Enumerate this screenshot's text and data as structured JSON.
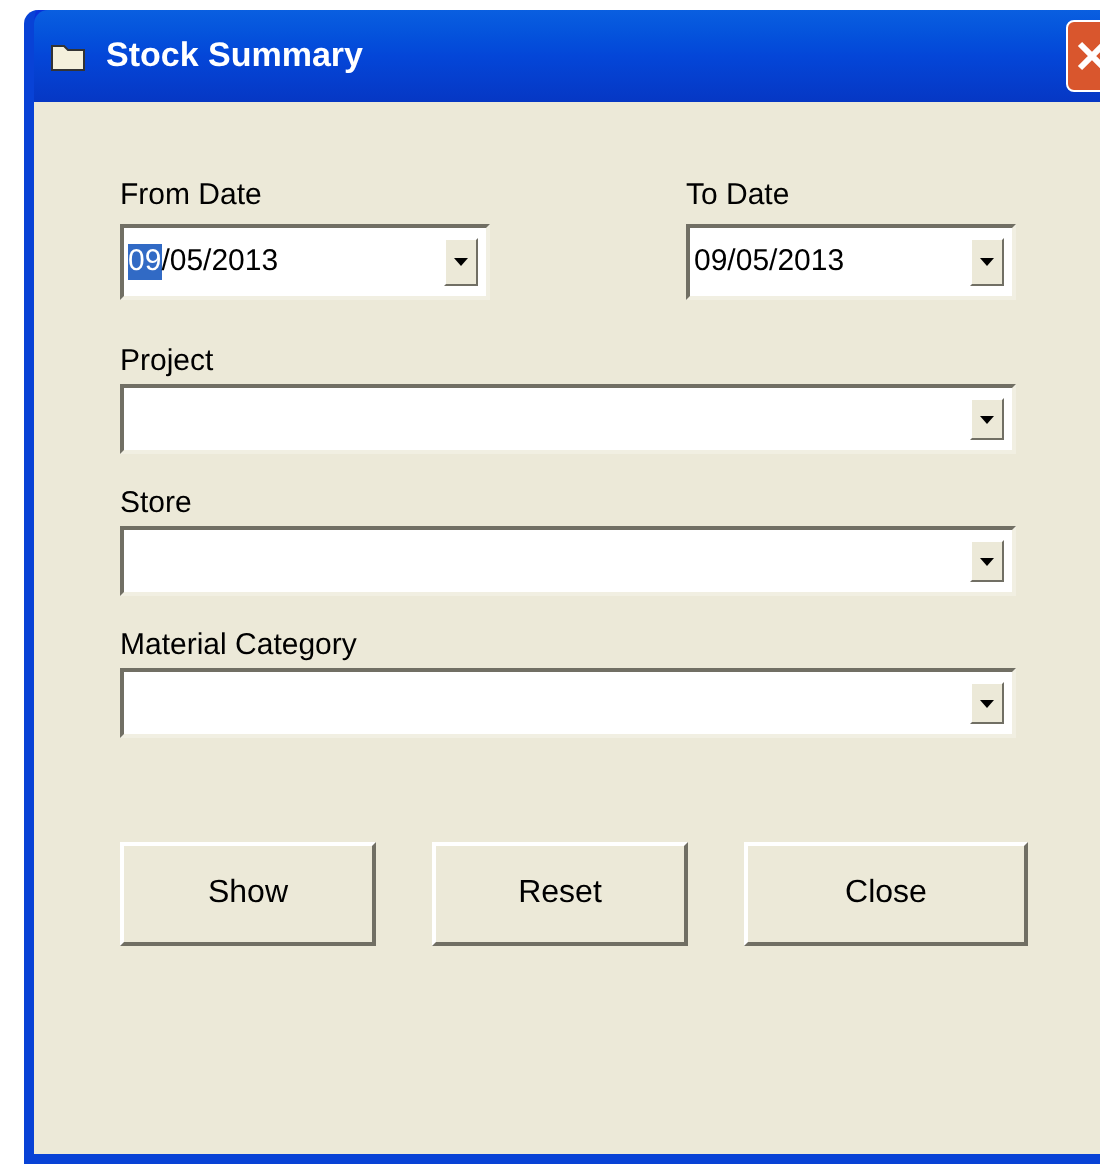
{
  "window": {
    "title": "Stock Summary"
  },
  "date_fields": [
    {
      "label": "From Date",
      "parts": [
        {
          "text": "09",
          "selected": true
        },
        {
          "text": "/05/2013",
          "selected": false
        }
      ]
    },
    {
      "label": "To Date",
      "parts": [
        {
          "text": "09/05/2013",
          "selected": false
        }
      ]
    }
  ],
  "combos": [
    {
      "label": "Project"
    },
    {
      "label": "Store"
    },
    {
      "label": "Material Category"
    }
  ],
  "buttons": [
    "Show",
    "Reset",
    "Close"
  ]
}
